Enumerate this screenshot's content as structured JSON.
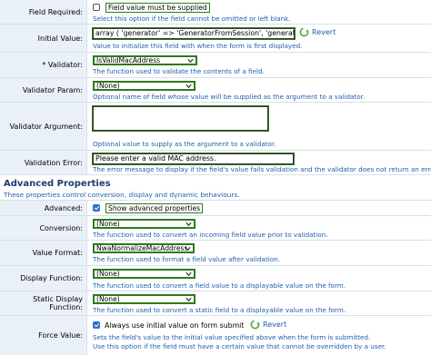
{
  "form": {
    "field_required": {
      "label": "Field Required:",
      "checkbox_label": "Field value must be supplied",
      "help": "Select this option if the field cannot be omitted or left blank."
    },
    "initial_value": {
      "label": "Initial Value:",
      "value": "array (  'generator' => 'GeneratorFromSession',  'generator",
      "revert_label": "Revert",
      "help": "Value to initialize this field with when the form is first displayed."
    },
    "validator": {
      "label": "* Validator:",
      "selected": "IsValidMacAddress",
      "help": "The function used to validate the contents of a field."
    },
    "validator_param": {
      "label": "Validator Param:",
      "selected": "(None)",
      "help": "Optional name of field whose value will be supplied as the argument to a validator."
    },
    "validator_argument": {
      "label": "Validator Argument:",
      "value": "",
      "help": "Optional value to supply as the argument to a validator."
    },
    "validation_error": {
      "label": "Validation Error:",
      "value": "Please enter a valid MAC address.",
      "help": "The error message to display if the field's value fails validation and the validator does not return an error"
    }
  },
  "advanced": {
    "title": "Advanced Properties",
    "subtitle": "These properties control conversion, display and dynamic behaviours.",
    "advanced": {
      "label": "Advanced:",
      "checkbox_label": "Show advanced properties",
      "checked": true
    },
    "conversion": {
      "label": "Conversion:",
      "selected": "(None)",
      "help": "The function used to convert an incoming field value prior to validation."
    },
    "value_format": {
      "label": "Value Format:",
      "selected": "NwaNormalizeMacAddress",
      "help": "The function used to format a field value after validation."
    },
    "display_function": {
      "label": "Display Function:",
      "selected": "(None)",
      "help": "The function used to convert a field value to a displayable value on the form."
    },
    "static_display_function": {
      "label": "Static Display Function:",
      "selected": "(None)",
      "help": "The function used to convert a static field to a displayable value on the form."
    },
    "force_value": {
      "label": "Force Value:",
      "checkbox_label": "Always use initial value on form submit",
      "checked": true,
      "revert_label": "Revert",
      "help1": "Sets the field's value to the initial value specified above when the form is submitted.",
      "help2": "Use this option if the field must have a certain value that cannot be overridden by a user."
    }
  },
  "colors": {
    "accent_green": "#2c7a1e",
    "help_blue": "#1f5fad",
    "label_bg": "#eaf0f7"
  }
}
